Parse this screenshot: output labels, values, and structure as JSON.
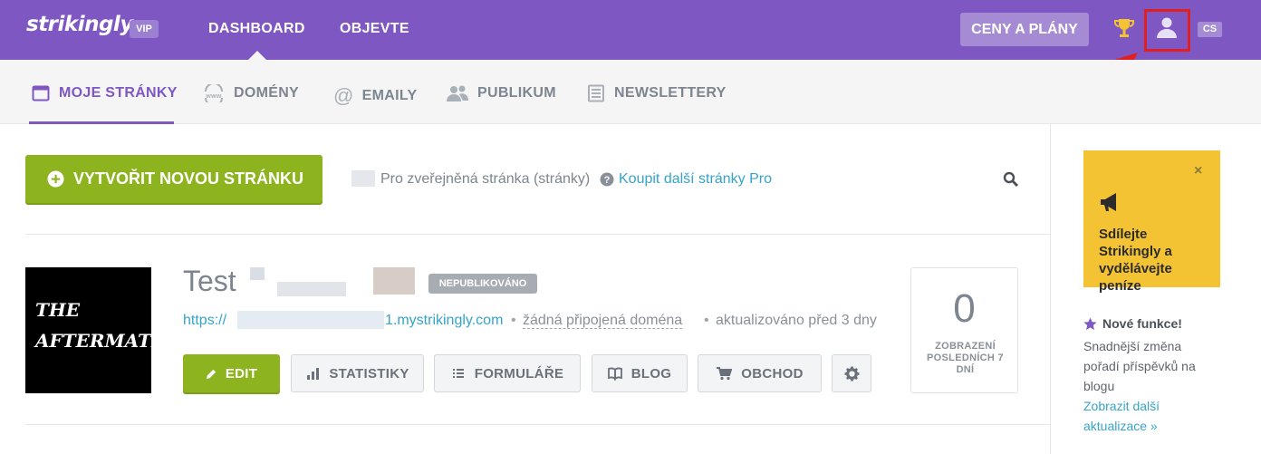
{
  "brand": {
    "logo": "strikingly",
    "badge": "VIP"
  },
  "topnav": {
    "dashboard": "DASHBOARD",
    "discover": "OBJEVTE",
    "plans_button": "CENY A PLÁNY",
    "language": "CS"
  },
  "subnav": {
    "tabs": [
      {
        "label": "MOJE STRÁNKY",
        "icon": "browser-icon",
        "active": true
      },
      {
        "label": "DOMÉNY",
        "icon": "www-icon"
      },
      {
        "label": "EMAILY",
        "icon": "at-icon"
      },
      {
        "label": "PUBLIKUM",
        "icon": "users-icon"
      },
      {
        "label": "NEWSLETTERY",
        "icon": "newsletter-icon"
      }
    ]
  },
  "main": {
    "create_button": "VYTVOŘIT NOVOU STRÁNKU",
    "pro_text": "Pro zveřejněná stránka (stránky)",
    "pro_link": "Koupit další stránky Pro"
  },
  "site": {
    "thumbnail_text": [
      "THE",
      "AFTERMATH"
    ],
    "title": "Test",
    "status": "NEPUBLIKOVÁNO",
    "url_prefix": "https://",
    "url_suffix": "1.mystrikingly.com",
    "domain_text": "žádná připojená doména",
    "updated_text": "aktualizováno před 3 dny",
    "buttons": {
      "edit": "EDIT",
      "stats": "STATISTIKY",
      "forms": "FORMULÁŘE",
      "blog": "BLOG",
      "shop": "OBCHOD"
    },
    "views": {
      "count": "0",
      "label": "ZOBRAZENÍ POSLEDNÍCH 7 DNÍ"
    }
  },
  "sidebar": {
    "promo_close": "×",
    "promo_text": "Sdílejte Strikingly a vydělávejte peníze",
    "news_title": "Nové funkce!",
    "news_body": "Snadnější změna pořadí příspěvků na blogu",
    "news_link": "Zobrazit další aktualizace »"
  },
  "colors": {
    "brand_purple": "#7e57c2",
    "green": "#8db41f",
    "link": "#36a3c9",
    "promo_yellow": "#f4c333",
    "highlight_red": "#e02020"
  }
}
